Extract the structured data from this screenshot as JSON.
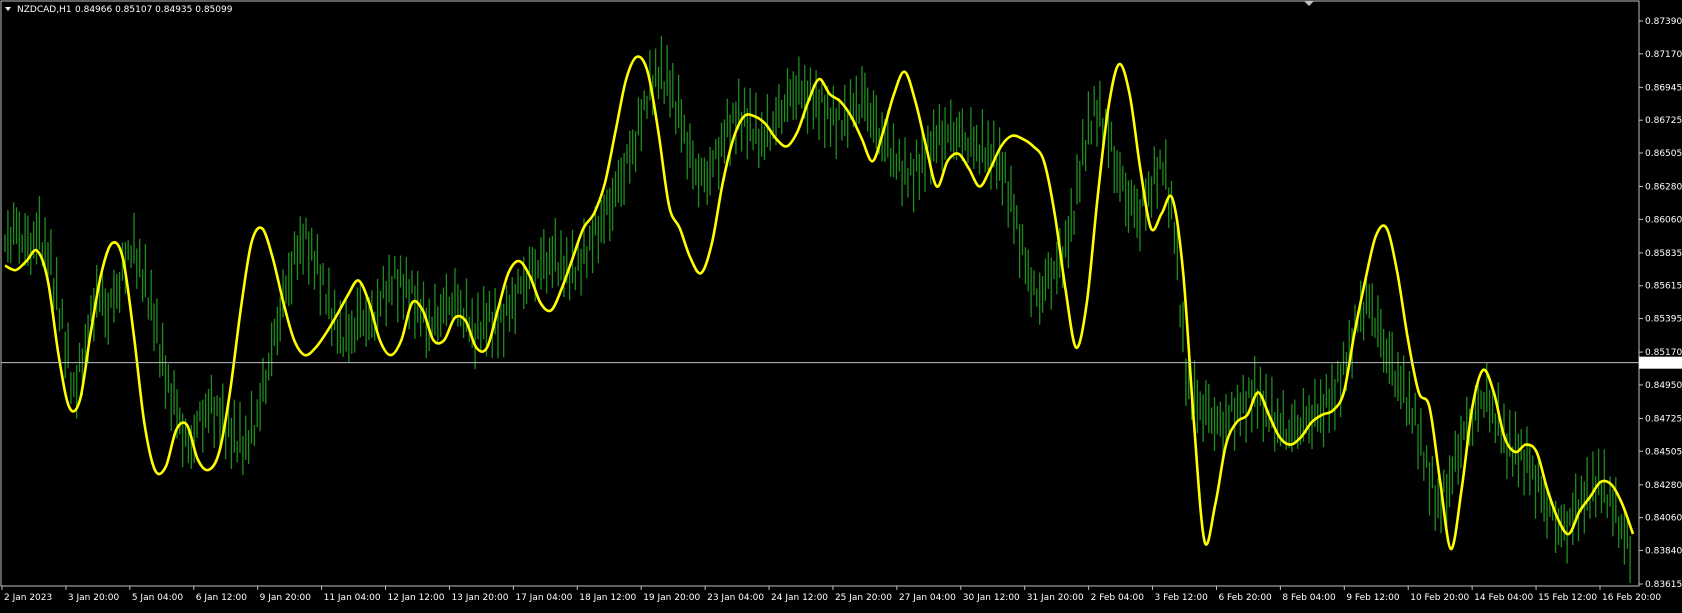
{
  "header": {
    "symbol": "NZDCAD,H1",
    "ohlc": "0.84966 0.85107 0.84935 0.85099",
    "menu_icon": "triangle-down-icon"
  },
  "price_marker": {
    "value": "0.85099",
    "color": "#c0c0c0"
  },
  "colors": {
    "background": "#000000",
    "candles": "#1e8c1e",
    "indicator": "#ffff00",
    "frame": "#c0c0c0",
    "text": "#ffffff"
  },
  "chart_data": {
    "type": "line",
    "title": "",
    "xlabel": "",
    "ylabel": "",
    "ylim": [
      0.8361,
      0.8748
    ],
    "grid": false,
    "y_ticks": [
      "0.87390",
      "0.87170",
      "0.86945",
      "0.86725",
      "0.86505",
      "0.86280",
      "0.86060",
      "0.85835",
      "0.85615",
      "0.85395",
      "0.85170",
      "0.84950",
      "0.84725",
      "0.84505",
      "0.84280",
      "0.84060",
      "0.83840",
      "0.83615"
    ],
    "x_ticks": [
      "2 Jan 2023",
      "3 Jan 20:00",
      "5 Jan 04:00",
      "6 Jan 12:00",
      "9 Jan 20:00",
      "11 Jan 04:00",
      "12 Jan 12:00",
      "13 Jan 20:00",
      "17 Jan 04:00",
      "18 Jan 12:00",
      "19 Jan 20:00",
      "23 Jan 04:00",
      "24 Jan 12:00",
      "25 Jan 20:00",
      "27 Jan 04:00",
      "30 Jan 12:00",
      "31 Jan 20:00",
      "2 Feb 04:00",
      "3 Feb 12:00",
      "6 Feb 20:00",
      "8 Feb 04:00",
      "9 Feb 12:00",
      "10 Feb 20:00",
      "14 Feb 04:00",
      "15 Feb 12:00",
      "16 Feb 20:00"
    ],
    "current_price": 0.85099,
    "series": [
      {
        "type": "bars",
        "color": "#1e8c1e",
        "values": [
          0.859,
          0.8598,
          0.8585,
          0.8595,
          0.8575,
          0.8535,
          0.849,
          0.852,
          0.856,
          0.8545,
          0.8565,
          0.859,
          0.857,
          0.854,
          0.85,
          0.8475,
          0.845,
          0.847,
          0.848,
          0.847,
          0.846,
          0.8455,
          0.8475,
          0.851,
          0.8545,
          0.8575,
          0.8595,
          0.858,
          0.8555,
          0.853,
          0.8525,
          0.854,
          0.8535,
          0.8555,
          0.8565,
          0.856,
          0.855,
          0.8535,
          0.8545,
          0.8555,
          0.8545,
          0.853,
          0.854,
          0.8535,
          0.8545,
          0.856,
          0.857,
          0.8575,
          0.858,
          0.857,
          0.8575,
          0.859,
          0.8605,
          0.862,
          0.864,
          0.866,
          0.869,
          0.8705,
          0.8695,
          0.867,
          0.864,
          0.863,
          0.8645,
          0.8665,
          0.8675,
          0.867,
          0.866,
          0.867,
          0.8685,
          0.8695,
          0.869,
          0.8685,
          0.8675,
          0.867,
          0.868,
          0.8685,
          0.8665,
          0.8655,
          0.864,
          0.8635,
          0.8645,
          0.866,
          0.8665,
          0.8665,
          0.866,
          0.8655,
          0.865,
          0.864,
          0.861,
          0.8575,
          0.855,
          0.8565,
          0.8575,
          0.86,
          0.865,
          0.868,
          0.867,
          0.864,
          0.862,
          0.861,
          0.863,
          0.8645,
          0.86,
          0.85,
          0.848,
          0.8475,
          0.8465,
          0.8475,
          0.848,
          0.849,
          0.848,
          0.847,
          0.8465,
          0.847,
          0.8475,
          0.848,
          0.849,
          0.851,
          0.854,
          0.855,
          0.8525,
          0.8505,
          0.849,
          0.847,
          0.844,
          0.8415,
          0.843,
          0.846,
          0.8475,
          0.849,
          0.8475,
          0.8455,
          0.845,
          0.844,
          0.842,
          0.8405,
          0.8395,
          0.841,
          0.842,
          0.843,
          0.842,
          0.84,
          0.838
        ]
      },
      {
        "type": "line",
        "color": "#ffff00",
        "values": [
          0.8575,
          0.8572,
          0.8578,
          0.8585,
          0.8565,
          0.8515,
          0.848,
          0.8485,
          0.853,
          0.857,
          0.859,
          0.858,
          0.853,
          0.847,
          0.8438,
          0.844,
          0.8465,
          0.8468,
          0.8445,
          0.8438,
          0.845,
          0.849,
          0.8545,
          0.859,
          0.86,
          0.858,
          0.855,
          0.8525,
          0.8515,
          0.852,
          0.853,
          0.8542,
          0.8555,
          0.8565,
          0.855,
          0.8525,
          0.8515,
          0.8525,
          0.855,
          0.8545,
          0.8525,
          0.8525,
          0.854,
          0.8538,
          0.852,
          0.852,
          0.8545,
          0.857,
          0.8578,
          0.8568,
          0.855,
          0.8545,
          0.856,
          0.858,
          0.86,
          0.861,
          0.863,
          0.8665,
          0.87,
          0.8715,
          0.8705,
          0.8665,
          0.8615,
          0.86,
          0.858,
          0.857,
          0.859,
          0.863,
          0.866,
          0.8675,
          0.8675,
          0.867,
          0.866,
          0.8655,
          0.8665,
          0.8685,
          0.87,
          0.869,
          0.8685,
          0.8675,
          0.866,
          0.8645,
          0.8665,
          0.869,
          0.8705,
          0.8685,
          0.8655,
          0.8628,
          0.8645,
          0.865,
          0.864,
          0.8628,
          0.864,
          0.8655,
          0.8662,
          0.866,
          0.8655,
          0.8645,
          0.861,
          0.856,
          0.852,
          0.855,
          0.862,
          0.868,
          0.871,
          0.869,
          0.864,
          0.86,
          0.861,
          0.862,
          0.857,
          0.847,
          0.839,
          0.8415,
          0.8455,
          0.847,
          0.8475,
          0.849,
          0.8475,
          0.846,
          0.8455,
          0.846,
          0.847,
          0.8475,
          0.8478,
          0.849,
          0.853,
          0.8565,
          0.8595,
          0.86,
          0.857,
          0.8525,
          0.849,
          0.848,
          0.843,
          0.8385,
          0.8425,
          0.848,
          0.8505,
          0.849,
          0.846,
          0.845,
          0.8455,
          0.845,
          0.8425,
          0.8405,
          0.8395,
          0.841,
          0.842,
          0.843,
          0.8428,
          0.8415,
          0.8395
        ]
      }
    ]
  }
}
